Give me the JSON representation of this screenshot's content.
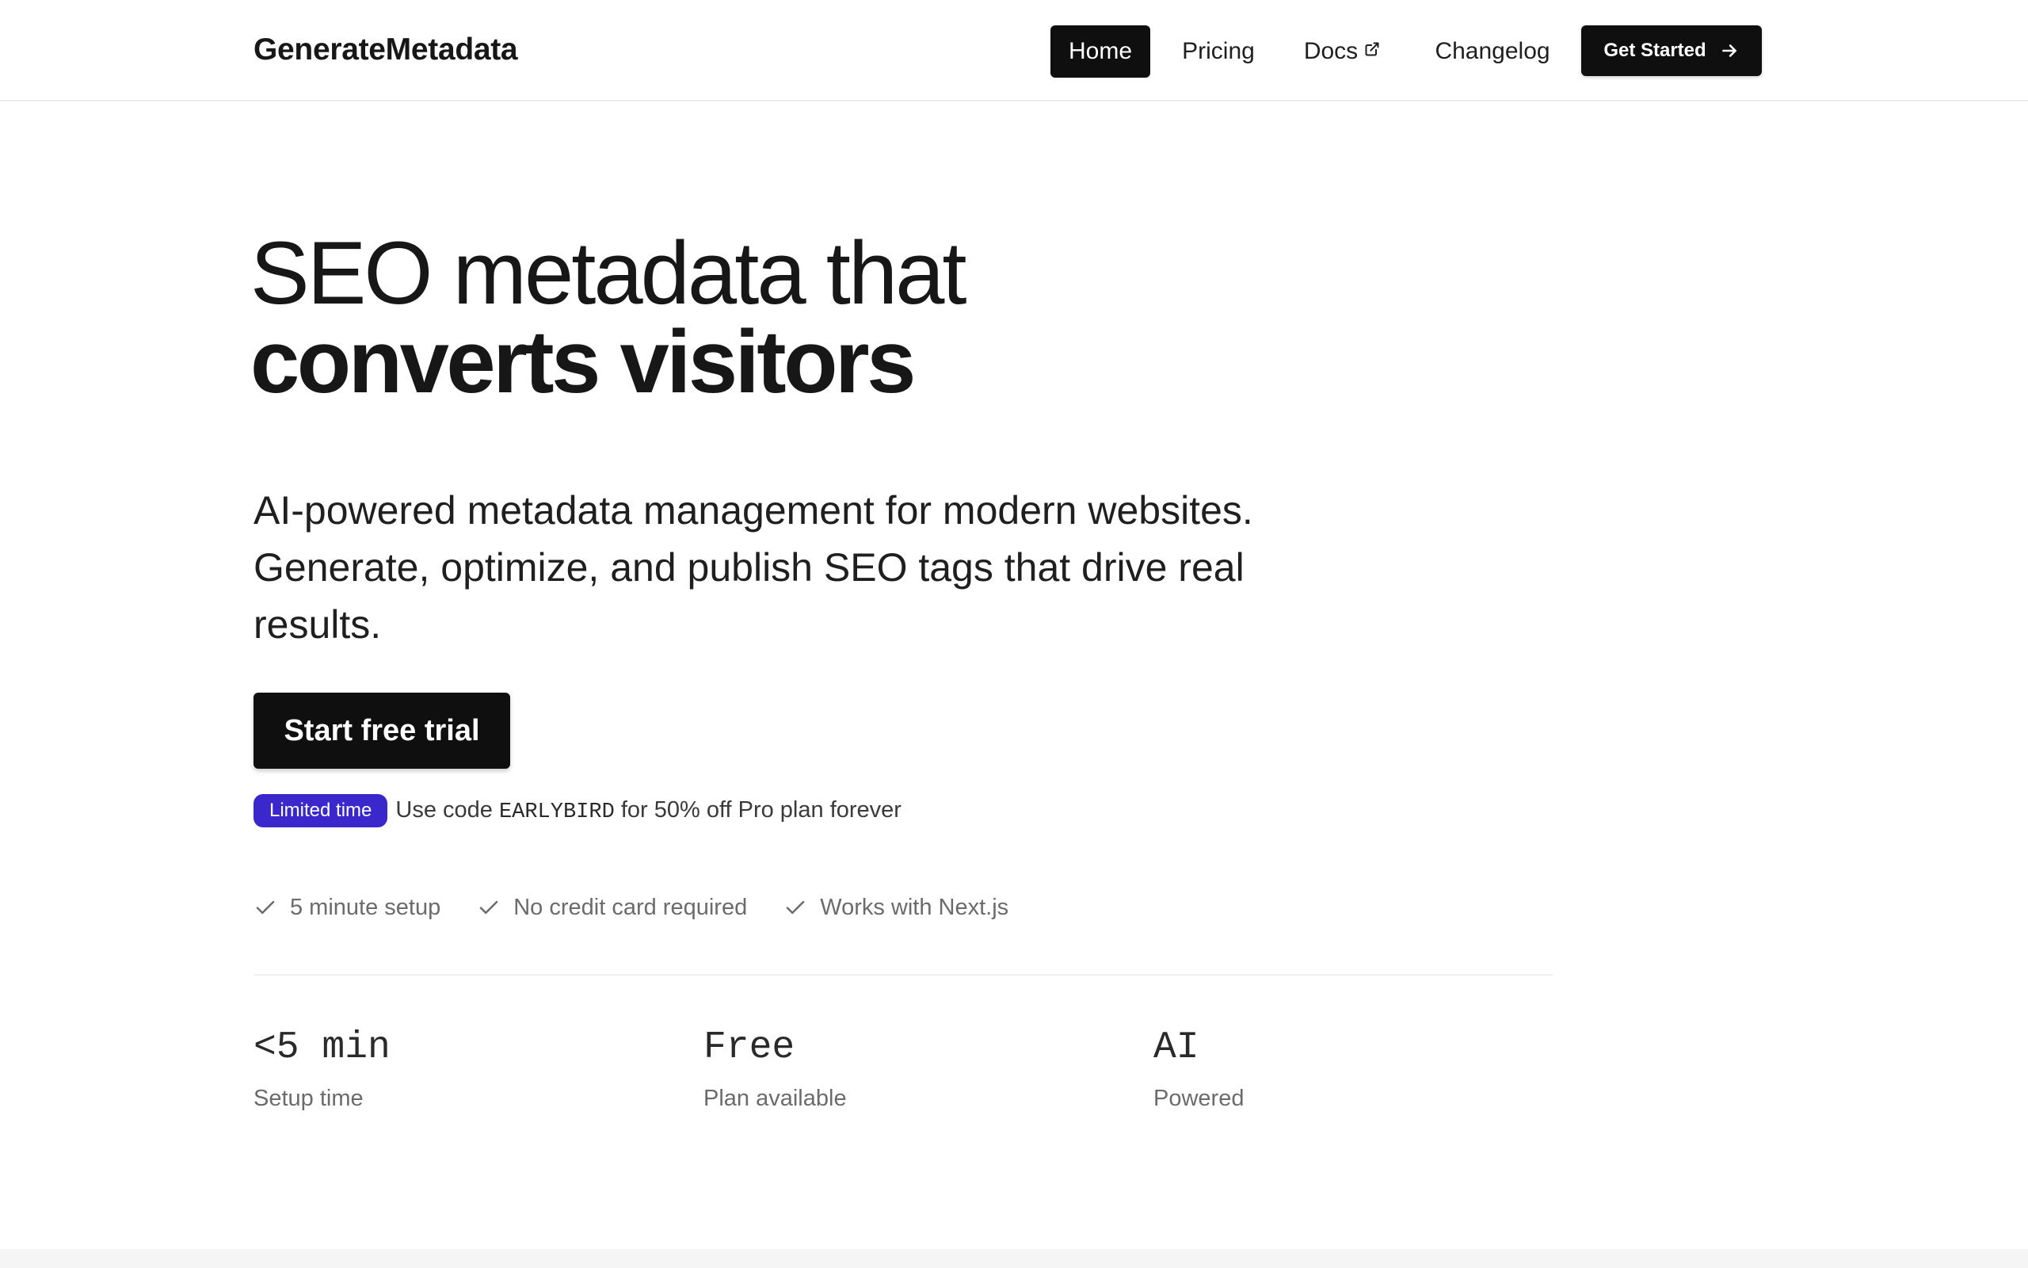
{
  "brand": "GenerateMetadata",
  "nav": {
    "items": [
      {
        "label": "Home",
        "active": true
      },
      {
        "label": "Pricing"
      },
      {
        "label": "Docs",
        "icon": "external-link-icon"
      },
      {
        "label": "Changelog"
      }
    ],
    "cta_label": "Get Started",
    "cta_icon": "arrow-right-icon"
  },
  "hero": {
    "title_line1": "SEO metadata that",
    "title_line2": "converts visitors",
    "subtitle": "AI-powered metadata management for modern websites. Generate, optimize, and publish SEO tags that drive real results.",
    "cta_label": "Start free trial"
  },
  "promo": {
    "badge": "Limited time",
    "text_before": "Use code",
    "code": "EARLYBIRD",
    "text_after": "for 50% off Pro plan forever"
  },
  "features": [
    {
      "label": "5 minute setup",
      "icon": "check-icon"
    },
    {
      "label": "No credit card required",
      "icon": "check-icon"
    },
    {
      "label": "Works with Next.js",
      "icon": "check-icon"
    }
  ],
  "stats": [
    {
      "value": "<5 min",
      "label": "Setup time"
    },
    {
      "value": "Free",
      "label": "Plan available"
    },
    {
      "value": "AI",
      "label": "Powered"
    }
  ],
  "colors": {
    "primary": "#0f0f10",
    "badge": "#3b28cc",
    "muted_text": "#6b6b6b",
    "background": "#ffffff"
  }
}
